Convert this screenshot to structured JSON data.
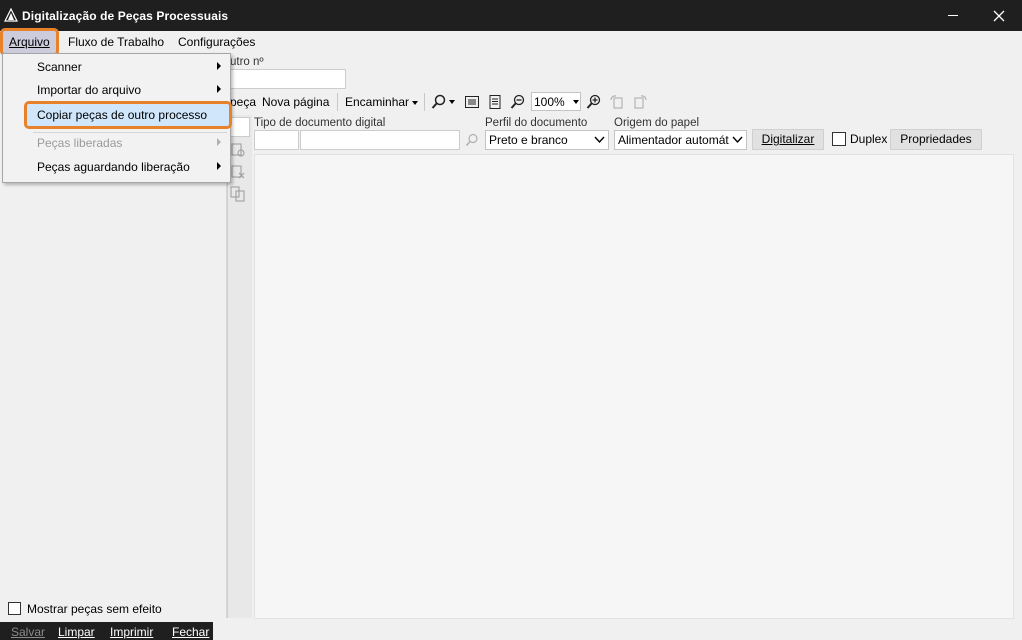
{
  "window": {
    "title": "Digitalização de Peças Processuais",
    "minimize_icon": "minimize-icon",
    "close_icon": "close-icon"
  },
  "menubar": {
    "arquivo": "Arquivo",
    "fluxo": "Fluxo de Trabalho",
    "configuracoes": "Configurações"
  },
  "arquivo_menu": {
    "items": [
      {
        "label": "Scanner",
        "submenu": true,
        "enabled": true
      },
      {
        "label": "Importar do arquivo",
        "submenu": true,
        "enabled": true
      },
      {
        "label": "Copiar peças de outro processo",
        "submenu": false,
        "enabled": true,
        "highlighted": true
      },
      {
        "label": "Peças liberadas",
        "submenu": true,
        "enabled": false
      },
      {
        "label": "Peças aguardando liberação",
        "submenu": true,
        "enabled": true
      }
    ]
  },
  "form": {
    "outro_label": "utro nº",
    "outro_value": ""
  },
  "toolbar": {
    "peca_label": "peça",
    "nova_pagina": "Nova página",
    "encaminhar": "Encaminhar",
    "zoom_value": "100%"
  },
  "doc_fields": {
    "tipo_label": "Tipo de documento digital",
    "tipo_code": "",
    "tipo_name": "",
    "perfil_label": "Perfil do documento",
    "perfil_value": "Preto e branco",
    "origem_label": "Origem do papel",
    "origem_value": "Alimentador automát",
    "digitalizar": "Digitalizar",
    "duplex": "Duplex",
    "propriedades": "Propriedades"
  },
  "left_panel": {
    "mostrar_label": "Mostrar peças sem efeito"
  },
  "bottom_bar": {
    "salvar": "Salvar",
    "limpar": "Limpar",
    "imprimir": "Imprimir",
    "fechar": "Fechar"
  },
  "colors": {
    "titlebar": "#1f1f1f",
    "highlight_outline": "#e8822a",
    "menu_selection": "#cfe6fb"
  }
}
